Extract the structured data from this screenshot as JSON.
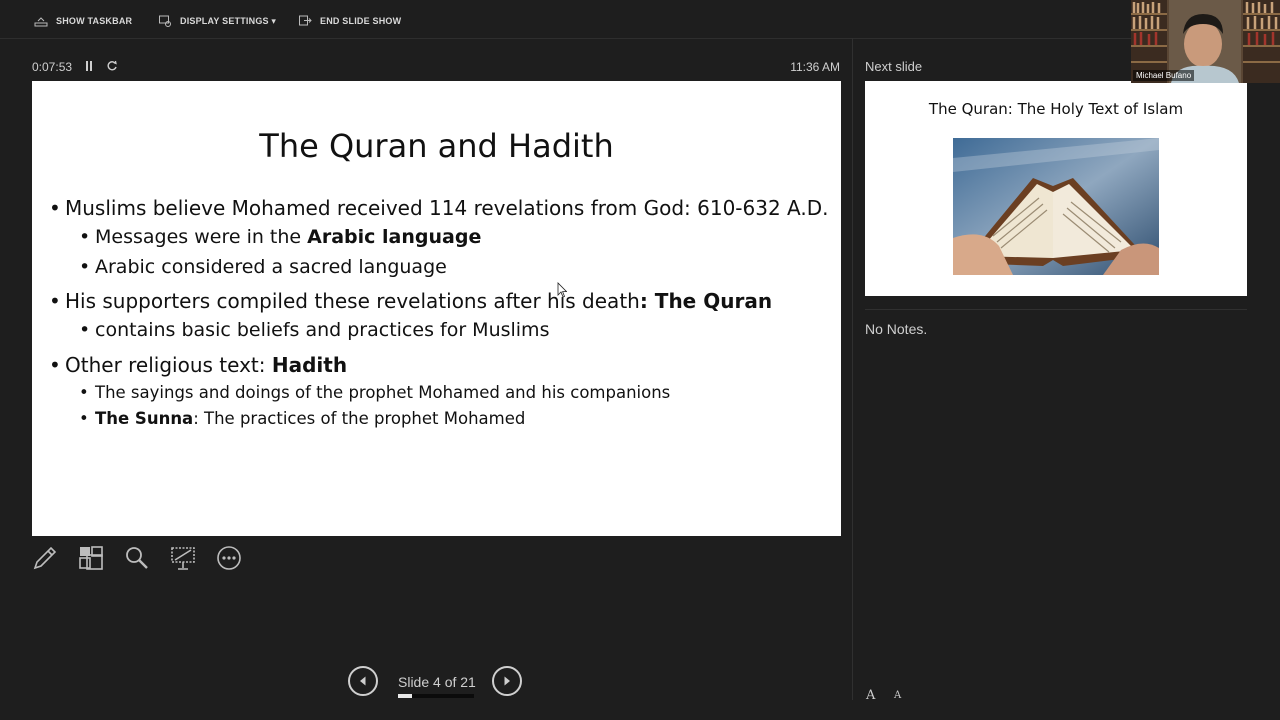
{
  "toolbar": {
    "show_taskbar": "SHOW TASKBAR",
    "display_settings": "DISPLAY SETTINGS ▾",
    "end_slide_show": "END SLIDE SHOW"
  },
  "timer": {
    "elapsed": "0:07:53",
    "clock": "11:36 AM"
  },
  "current_slide": {
    "title": "The Quran and Hadith",
    "bullets": [
      {
        "level": 1,
        "text": "Muslims believe Mohamed received 114 revelations from God: 610-632 A.D.",
        "bold": ""
      },
      {
        "level": 2,
        "text": "Messages were in the ",
        "bold": "Arabic language"
      },
      {
        "level": 2,
        "text": "Arabic considered a sacred language",
        "bold": ""
      },
      {
        "level": 1,
        "text": "His supporters compiled these revelations after his death",
        "bold": ": The Quran"
      },
      {
        "level": 2,
        "text": "contains basic beliefs and practices for Muslims",
        "bold": ""
      },
      {
        "level": 1,
        "text": "Other religious text: ",
        "bold": "Hadith"
      },
      {
        "level": 3,
        "text": "The sayings and doings of the prophet Mohamed and his companions",
        "bold": ""
      },
      {
        "level": 3,
        "bold_first": "The Sunna",
        "text": ": The practices of the prophet Mohamed"
      }
    ]
  },
  "tools": [
    "pen-icon",
    "slides-grid-icon",
    "zoom-icon",
    "screen-pointer-icon",
    "more-options-icon"
  ],
  "navigation": {
    "slide_label": "Slide 4 of 21",
    "current": 4,
    "total": 21
  },
  "next_slide": {
    "label": "Next slide",
    "title": "The Quran: The Holy Text of Islam"
  },
  "notes": {
    "text": "No Notes."
  },
  "font_controls": {
    "increase": "A",
    "decrease": "A"
  },
  "video": {
    "participant_name": "Michael Bufano"
  },
  "colors": {
    "background": "#1e1e1e",
    "text": "#d6d6d6",
    "slide_bg": "#ffffff"
  }
}
